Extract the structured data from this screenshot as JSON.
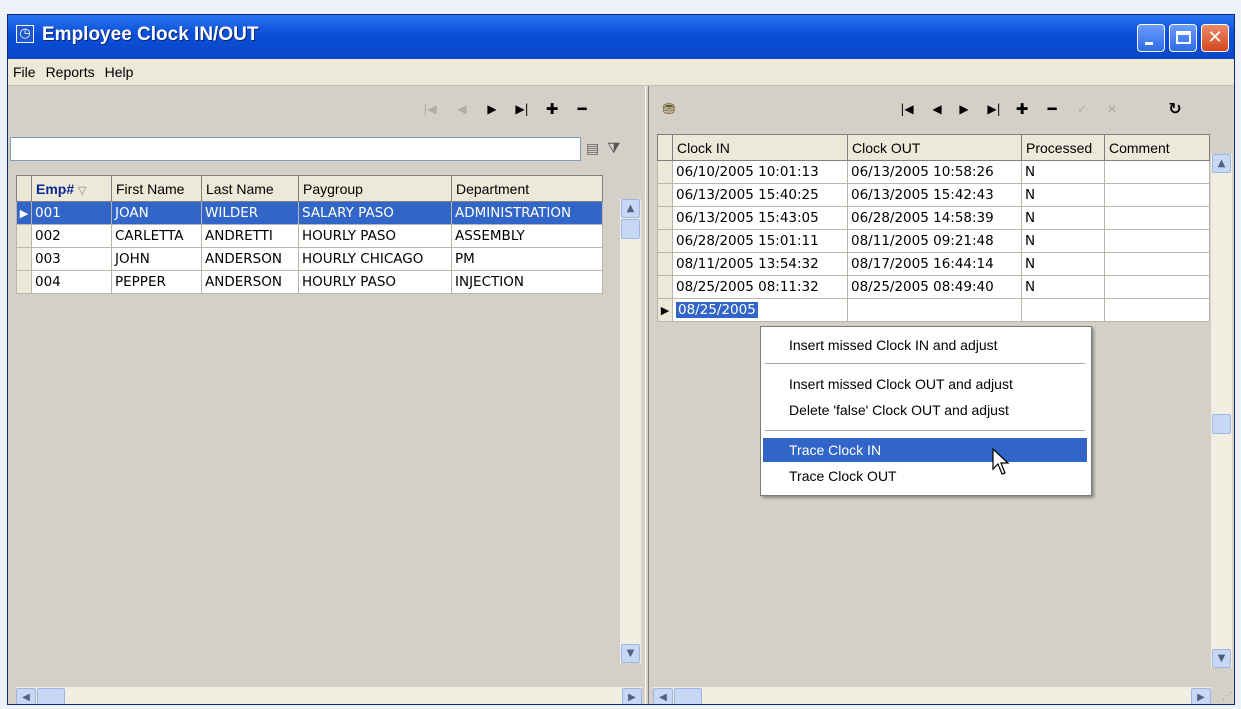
{
  "window": {
    "title": "Employee Clock IN/OUT",
    "app_icon": "clock-app-icon"
  },
  "menu": [
    "File",
    "Reports",
    "Help"
  ],
  "left_nav": {
    "buttons": [
      {
        "name": "first-record-button",
        "glyph": "|◀",
        "enabled": false
      },
      {
        "name": "prior-record-button",
        "glyph": "◀",
        "enabled": false
      },
      {
        "name": "next-record-button",
        "glyph": "▶",
        "enabled": true
      },
      {
        "name": "last-record-button",
        "glyph": "▶|",
        "enabled": true
      },
      {
        "name": "insert-record-button",
        "glyph": "✚",
        "enabled": true
      },
      {
        "name": "delete-record-button",
        "glyph": "━",
        "enabled": true
      }
    ]
  },
  "right_nav": {
    "buttons": [
      {
        "name": "first-record-button",
        "glyph": "|◀",
        "enabled": true
      },
      {
        "name": "prior-record-button",
        "glyph": "◀",
        "enabled": true
      },
      {
        "name": "next-record-button",
        "glyph": "▶",
        "enabled": true
      },
      {
        "name": "last-record-button",
        "glyph": "▶|",
        "enabled": true
      },
      {
        "name": "insert-record-button",
        "glyph": "✚",
        "enabled": true
      },
      {
        "name": "delete-record-button",
        "glyph": "━",
        "enabled": true
      },
      {
        "name": "post-edit-button",
        "glyph": "✓",
        "enabled": false
      },
      {
        "name": "cancel-edit-button",
        "glyph": "✕",
        "enabled": false
      },
      {
        "name": "refresh-button",
        "glyph": "↻",
        "enabled": true
      }
    ]
  },
  "filter": {
    "value": ""
  },
  "employees": {
    "columns": [
      "Emp#",
      "First Name",
      "Last Name",
      "Paygroup",
      "Department"
    ],
    "sort_indicator": "▽",
    "rows": [
      [
        "001",
        "JOAN",
        "WILDER",
        "SALARY PASO",
        "ADMINISTRATION"
      ],
      [
        "002",
        "CARLETTA",
        "ANDRETTI",
        "HOURLY PASO",
        "ASSEMBLY"
      ],
      [
        "003",
        "JOHN",
        "ANDERSON",
        "HOURLY CHICAGO",
        "PM"
      ],
      [
        "004",
        "PEPPER",
        "ANDERSON",
        "HOURLY PASO",
        "INJECTION"
      ]
    ],
    "selected_row": 0
  },
  "clock": {
    "columns": [
      "Clock IN",
      "Clock OUT",
      "Processed",
      "Comment"
    ],
    "rows": [
      [
        "06/10/2005 10:01:13",
        "06/13/2005 10:58:26",
        "N",
        ""
      ],
      [
        "06/13/2005 15:40:25",
        "06/13/2005 15:42:43",
        "N",
        ""
      ],
      [
        "06/13/2005 15:43:05",
        "06/28/2005 14:58:39",
        "N",
        ""
      ],
      [
        "06/28/2005 15:01:11",
        "08/11/2005 09:21:48",
        "N",
        ""
      ],
      [
        "08/11/2005 13:54:32",
        "08/17/2005 16:44:14",
        "N",
        ""
      ],
      [
        "08/25/2005 08:11:32",
        "08/25/2005 08:49:40",
        "N",
        ""
      ],
      [
        "08/25/2005",
        "",
        "",
        ""
      ]
    ],
    "selected_row": 6
  },
  "context_menu": {
    "items": [
      "Insert missed Clock IN and adjust",
      "Insert missed Clock OUT and adjust",
      "Delete 'false' Clock OUT and adjust",
      "Trace Clock IN",
      "Trace Clock OUT"
    ],
    "highlighted": 3
  },
  "colors": {
    "title_bar": "#0a4fd8",
    "selection": "#3166c8",
    "window_face": "#d4d0c8"
  }
}
